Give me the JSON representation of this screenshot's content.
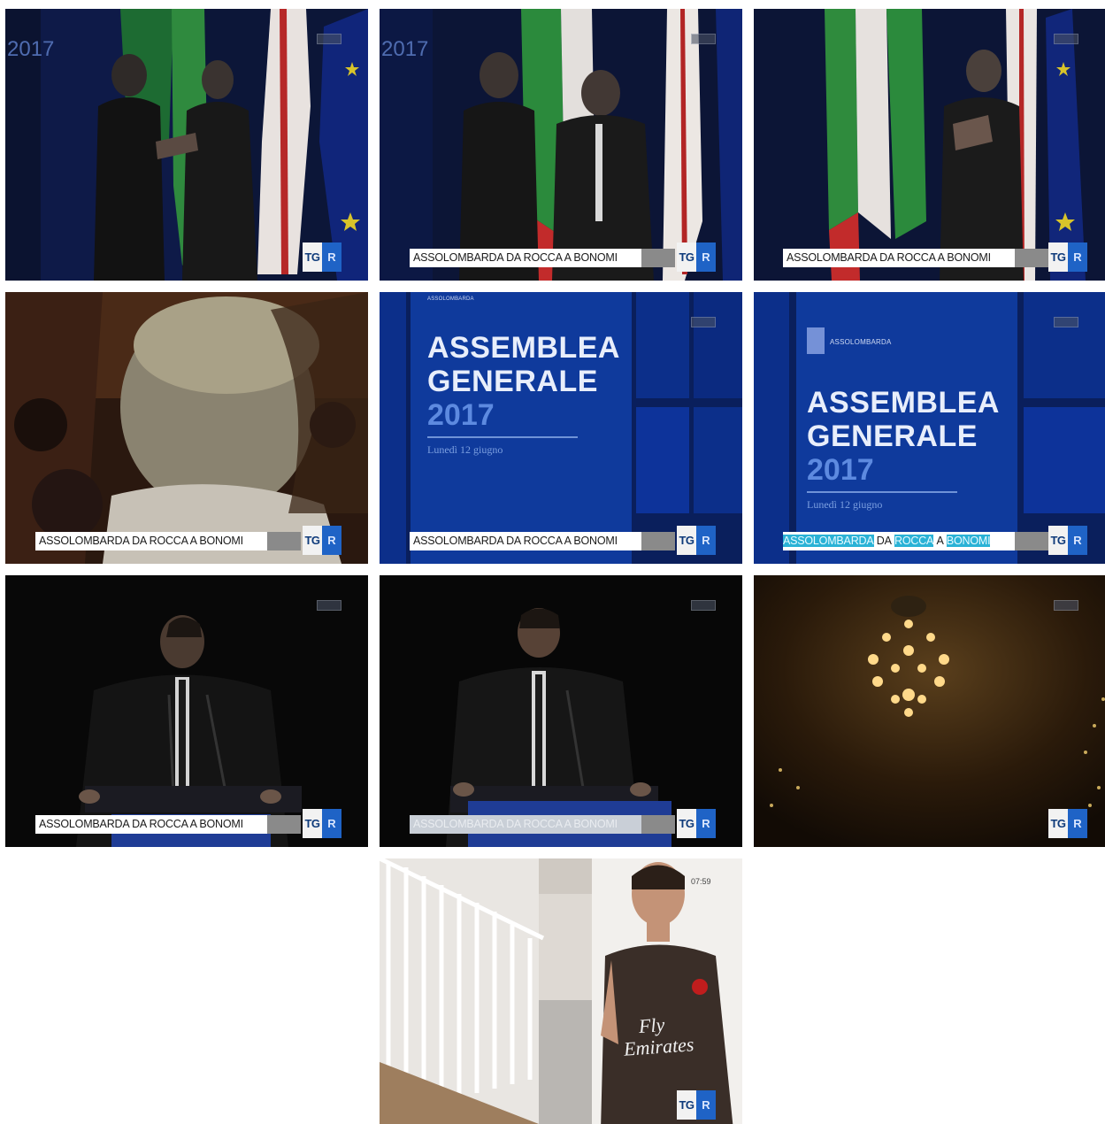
{
  "caption_text": "ASSOLOMBARDA DA ROCCA A BONOMI",
  "caption_words": [
    "ASSOLOMBARDA",
    "DA",
    "ROCCA",
    "A",
    "BONOMI"
  ],
  "logo": {
    "tg": "TG",
    "r": "R"
  },
  "assemblea": {
    "org": "ASSOLOMBARDA",
    "line1": "ASSEMBLEA",
    "line2": "GENERALE",
    "year": "2017",
    "date": "Lunedì 12 giugno"
  },
  "corner_year": "2017",
  "clock": "07:59",
  "jersey": {
    "line1": "Fly",
    "line2": "Emirates"
  },
  "colors": {
    "highlight": "#2ab2d6",
    "logo_blue": "#1f63c6"
  }
}
